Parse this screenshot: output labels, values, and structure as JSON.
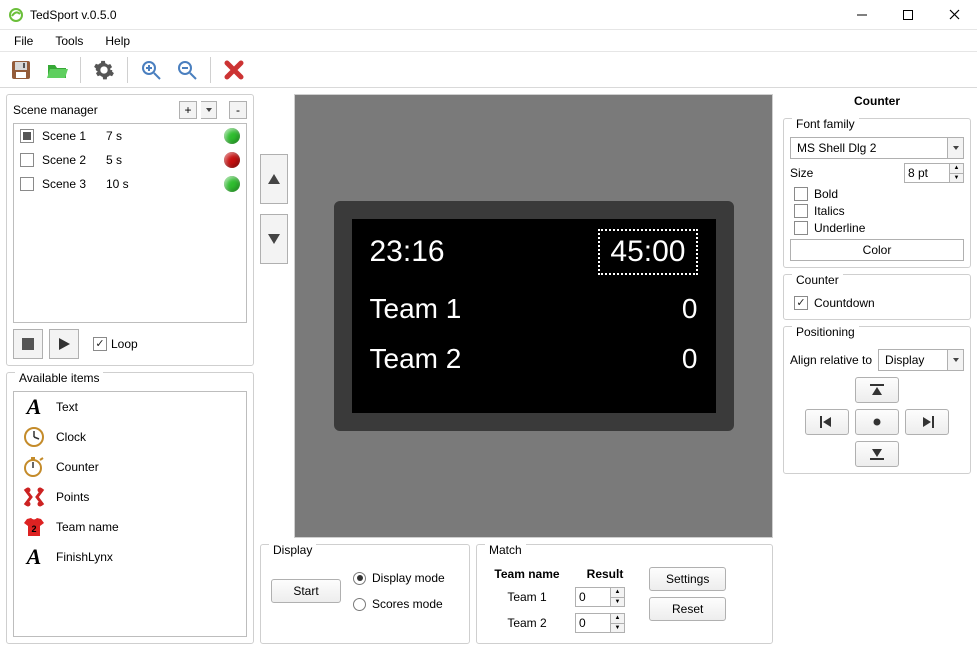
{
  "app": {
    "title": "TedSport v.0.5.0"
  },
  "menu": {
    "file": "File",
    "tools": "Tools",
    "help": "Help"
  },
  "toolbar": {
    "save": "save-icon",
    "open": "open-icon",
    "settings": "gear-icon",
    "zoom_in": "zoom-in-icon",
    "zoom_out": "zoom-out-icon",
    "delete": "delete-icon"
  },
  "scene_manager": {
    "label": "Scene manager",
    "add_label": "+",
    "remove_label": "-",
    "loop_label": "Loop",
    "loop_checked": true,
    "scenes": [
      {
        "checked": true,
        "name": "Scene 1",
        "duration": "7 s",
        "status": "green"
      },
      {
        "checked": false,
        "name": "Scene 2",
        "duration": "5 s",
        "status": "red"
      },
      {
        "checked": false,
        "name": "Scene 3",
        "duration": "10 s",
        "status": "green"
      }
    ]
  },
  "available_items": {
    "label": "Available items",
    "items": [
      {
        "name": "Text",
        "icon": "text"
      },
      {
        "name": "Clock",
        "icon": "clock"
      },
      {
        "name": "Counter",
        "icon": "counter"
      },
      {
        "name": "Points",
        "icon": "points"
      },
      {
        "name": "Team name",
        "icon": "jersey"
      },
      {
        "name": "FinishLynx",
        "icon": "text"
      }
    ]
  },
  "canvas": {
    "time": "23:16",
    "counter": "45:00",
    "team1": "Team 1",
    "team1_score": "0",
    "team2": "Team 2",
    "team2_score": "0"
  },
  "display_panel": {
    "label": "Display",
    "start_label": "Start",
    "display_mode": "Display mode",
    "scores_mode": "Scores mode",
    "selected": "display"
  },
  "match_panel": {
    "label": "Match",
    "teamname_hdr": "Team name",
    "result_hdr": "Result",
    "team1": "Team 1",
    "team2": "Team 2",
    "score1": "0",
    "score2": "0",
    "settings_label": "Settings",
    "reset_label": "Reset"
  },
  "props": {
    "title": "Counter",
    "font_family_label": "Font family",
    "font_family_value": "MS Shell Dlg 2",
    "size_label": "Size",
    "size_value": "8 pt",
    "bold_label": "Bold",
    "italics_label": "Italics",
    "underline_label": "Underline",
    "color_label": "Color",
    "counter_group": "Counter",
    "countdown_label": "Countdown",
    "countdown_checked": true,
    "positioning_label": "Positioning",
    "align_label": "Align relative to",
    "align_value": "Display"
  }
}
